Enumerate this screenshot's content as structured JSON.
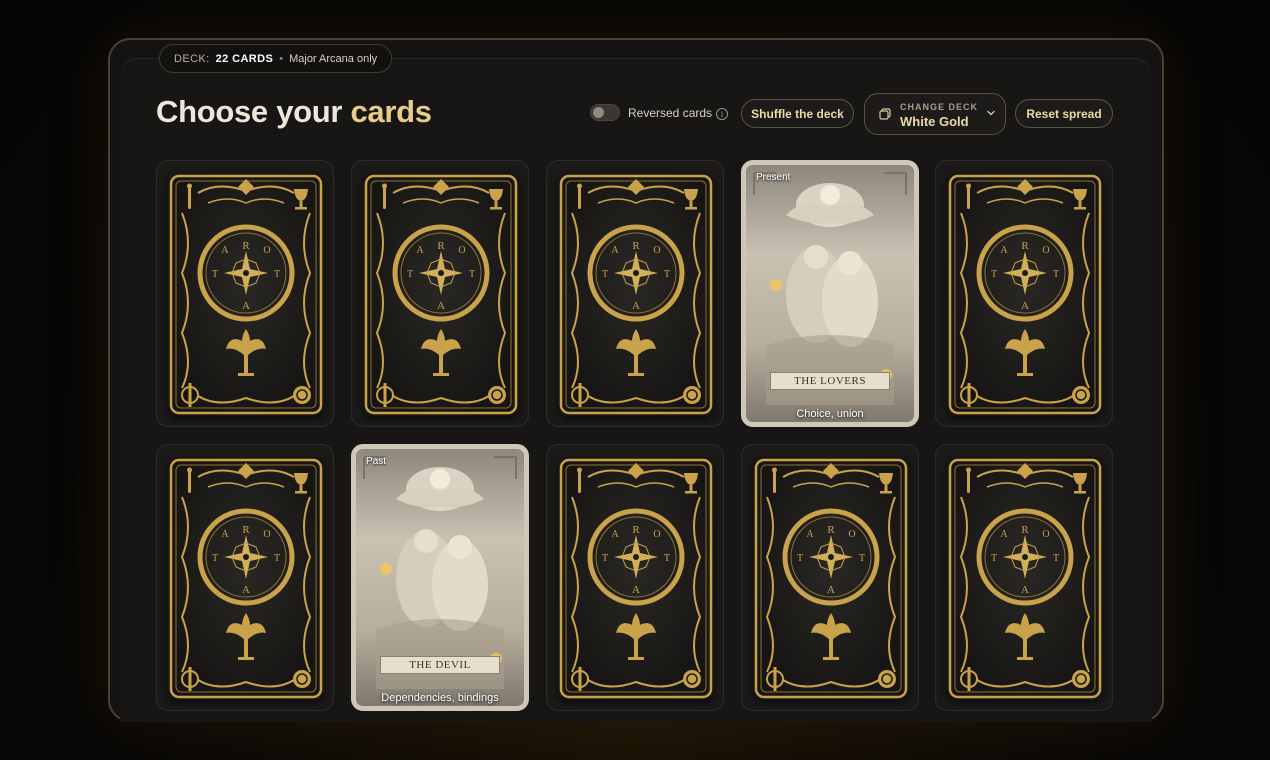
{
  "deck_pill": {
    "label": "DECK:",
    "count": "22 CARDS",
    "separator": "•",
    "note": "Major Arcana only"
  },
  "title": {
    "main": "Choose your ",
    "accent": "cards"
  },
  "reversed_toggle": {
    "label": "Reversed cards",
    "on": false
  },
  "info_icon": {
    "glyph": "i"
  },
  "shuffle_button": {
    "label": "Shuffle the deck"
  },
  "change_deck": {
    "caption": "CHANGE DECK",
    "value": "White Gold"
  },
  "reset_button": {
    "label": "Reset spread"
  },
  "colors": {
    "gold": "#c9a24a",
    "accent_text": "#e8cc8a",
    "background": "#171615"
  },
  "cards": [
    {
      "state": "back"
    },
    {
      "state": "back"
    },
    {
      "state": "back"
    },
    {
      "state": "face",
      "position": "Present",
      "name": "THE LOVERS",
      "meaning": "Choice, union"
    },
    {
      "state": "back"
    },
    {
      "state": "back"
    },
    {
      "state": "face",
      "position": "Past",
      "name": "THE DEVIL",
      "meaning": "Dependencies, bindings"
    },
    {
      "state": "back"
    },
    {
      "state": "back"
    },
    {
      "state": "back"
    }
  ],
  "card_back_letters": {
    "top": "R",
    "left": "T",
    "right": "O",
    "bottom": "A",
    "inner_left": "A",
    "inner_right": "T"
  }
}
